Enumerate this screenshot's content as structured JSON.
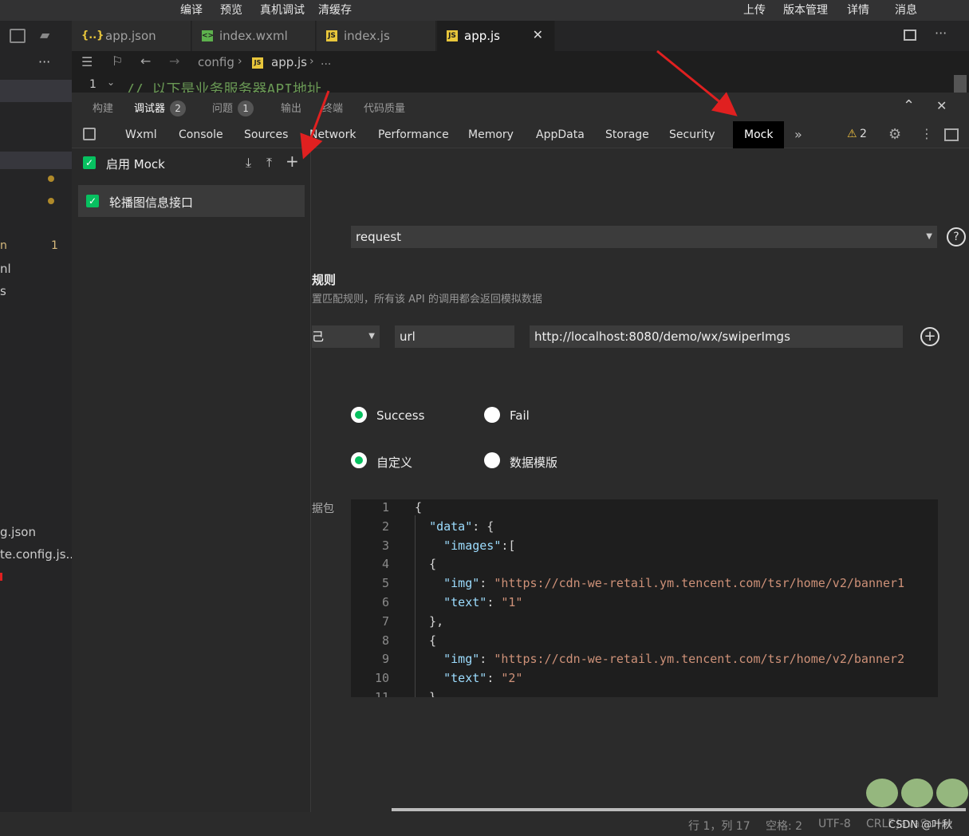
{
  "menubar": {
    "left": [
      "编译",
      "预览",
      "真机调试",
      "清缓存"
    ],
    "right": [
      "上传",
      "版本管理",
      "详情",
      "消息"
    ]
  },
  "tabs": [
    {
      "label": "app.json",
      "icon": "json"
    },
    {
      "label": "index.wxml",
      "icon": "wxml"
    },
    {
      "label": "index.js",
      "icon": "js"
    },
    {
      "label": "app.js",
      "icon": "js"
    }
  ],
  "breadcrumb": {
    "folder": "config",
    "file": "app.js",
    "more": "..."
  },
  "code_line": {
    "number": "1",
    "text": "// 以下是业务服务器API地址"
  },
  "devtools_tabs": [
    {
      "label": "构建"
    },
    {
      "label": "调试器",
      "badge": "2"
    },
    {
      "label": "问题",
      "badge": "1"
    },
    {
      "label": "输出"
    },
    {
      "label": "终端"
    },
    {
      "label": "代码质量"
    }
  ],
  "panel_tabs": [
    "Wxml",
    "Console",
    "Sources",
    "Network",
    "Performance",
    "Memory",
    "AppData",
    "Storage",
    "Security",
    "Mock"
  ],
  "warning_count": "2",
  "left_files": [
    "n",
    "nl",
    "s",
    "g.json",
    "te.config.js..."
  ],
  "left_file_badge": "1",
  "mock": {
    "enable_label": "启用 Mock",
    "rule_item": "轮播图信息接口",
    "api_select": "request",
    "rules_title": "规则",
    "rules_desc": "置匹配规则，所有该 API 的调用都会返回模拟数据",
    "match_select": "己",
    "match_key": "url",
    "match_value": "http://localhost:8080/demo/wx/swiperImgs",
    "result_success": "Success",
    "result_fail": "Fail",
    "type_custom": "自定义",
    "type_template": "数据模版",
    "data_label": "据包"
  },
  "editor_lines": [
    {
      "n": "1",
      "t": "{"
    },
    {
      "n": "2",
      "t": "  \"data\": {"
    },
    {
      "n": "3",
      "t": "    \"images\":["
    },
    {
      "n": "4",
      "t": "  {"
    },
    {
      "n": "5",
      "t": "    \"img\": \"https://cdn-we-retail.ym.tencent.com/tsr/home/v2/banner1"
    },
    {
      "n": "6",
      "t": "    \"text\": \"1\""
    },
    {
      "n": "7",
      "t": "  },"
    },
    {
      "n": "8",
      "t": "  {"
    },
    {
      "n": "9",
      "t": "    \"img\": \"https://cdn-we-retail.ym.tencent.com/tsr/home/v2/banner2"
    },
    {
      "n": "10",
      "t": "    \"text\": \"2\""
    },
    {
      "n": "11",
      "t": "  }"
    }
  ],
  "status": {
    "position": "行 1，列 17",
    "spaces": "空格: 2",
    "encoding": "UTF-8",
    "eol": "CRLF",
    "lang": "JavaScript",
    "watermark": "CSDN @叶秋"
  },
  "colors": {
    "accent": "#07c160",
    "arrow": "#e02020"
  }
}
